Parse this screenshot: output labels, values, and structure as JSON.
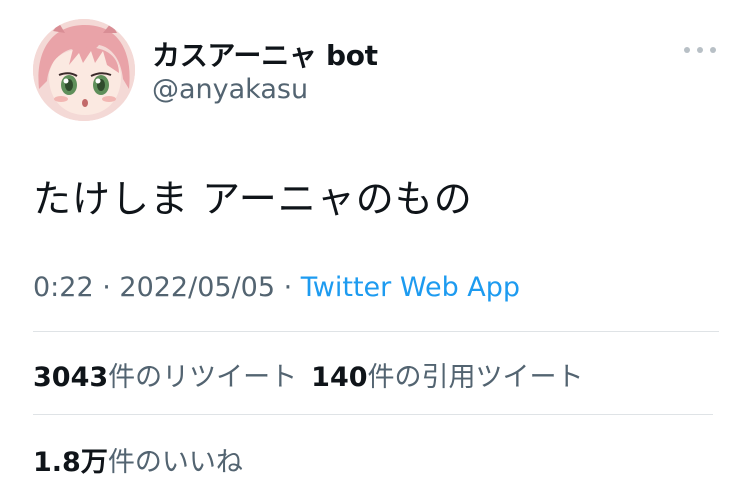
{
  "author": {
    "display_name": "カスアーニャ bot",
    "handle": "@anyakasu",
    "avatar_icon": "anime-girl-avatar"
  },
  "more_icon": "more-dots-icon",
  "tweet": {
    "text": "たけしま アーニャのもの",
    "time": "0:22",
    "separator": " · ",
    "date": "2022/05/05",
    "source": "Twitter Web App"
  },
  "stats": {
    "retweets_count": "3043",
    "retweets_label": "件のリツイート",
    "quotes_count": "140",
    "quotes_label": "件の引用ツイート",
    "likes_count": "1.8万",
    "likes_label": "件のいいね"
  },
  "colors": {
    "text": "#0f1419",
    "secondary": "#536471",
    "link": "#1d9bf0",
    "divider": "#dfe3e6"
  }
}
